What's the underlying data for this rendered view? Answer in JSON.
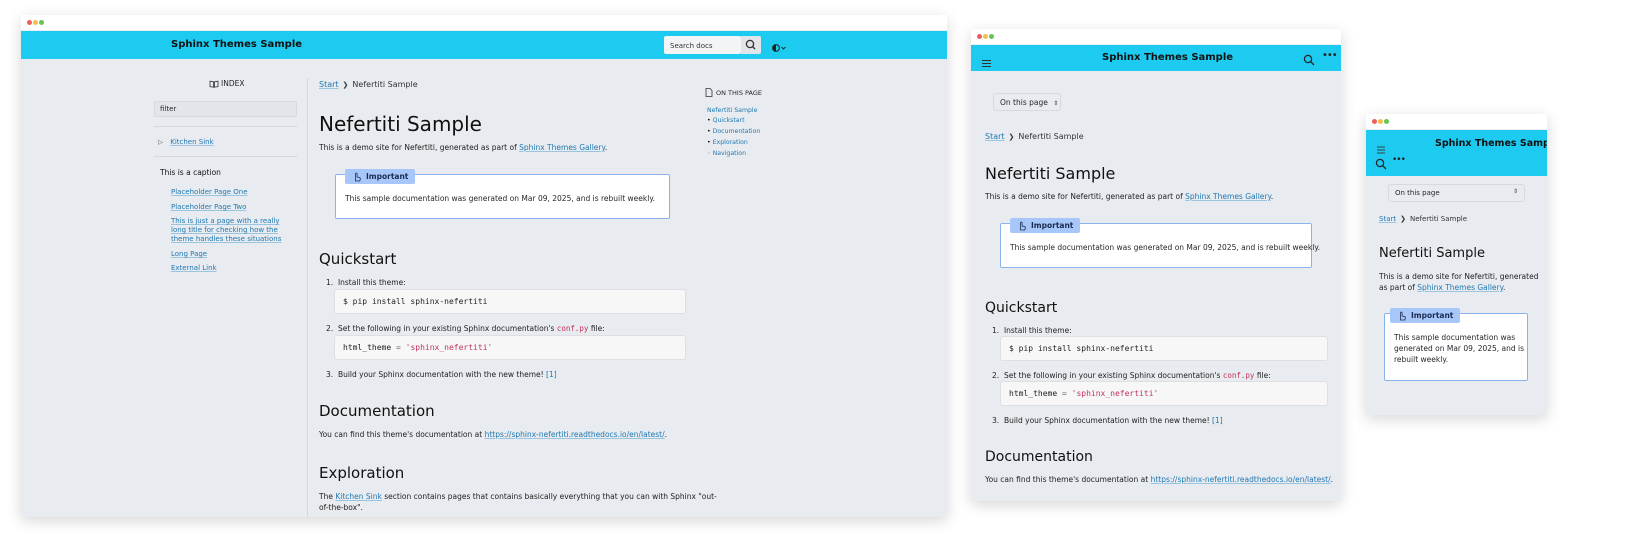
{
  "site_title": "Sphinx Themes Sample",
  "search": {
    "placeholder": "Search docs"
  },
  "sidebar": {
    "index_label": "INDEX",
    "filter_value": "filter",
    "kitchen_sink": "Kitchen Sink",
    "caption": "This is a caption",
    "pages": [
      "Placeholder Page One",
      "Placeholder Page Two",
      "This is just a page with a really long title for checking how the theme handles these situations",
      "Long Page",
      "External Link"
    ]
  },
  "toc": {
    "title": "ON THIS PAGE",
    "items": [
      "Nefertiti Sample",
      "Quickstart",
      "Documentation",
      "Exploration",
      "Navigation"
    ],
    "mobile_button": "On this page"
  },
  "breadcrumb": {
    "start": "Start",
    "current": "Nefertiti Sample"
  },
  "content": {
    "title": "Nefertiti Sample",
    "intro_before": "This is a demo site for Nefertiti, generated as part of ",
    "intro_link": "Sphinx Themes Gallery",
    "intro_after": ".",
    "intro_narrow_line1": "This is a demo site for Nefertiti, generated",
    "intro_narrow_line2_before": "as part of ",
    "admonition_title": "Important",
    "admonition_text": "This sample documentation was generated on Mar 09, 2025, and is rebuilt weekly.",
    "admonition_narrow": [
      "This sample documentation was",
      "generated on Mar 09, 2025, and is",
      "rebuilt weekly."
    ],
    "quickstart_heading": "Quickstart",
    "step1": "Install this theme:",
    "step1_code": "$ pip install sphinx-nefertiti",
    "step2_before": "Set the following in your existing Sphinx documentation's ",
    "step2_code": "conf.py",
    "step2_after": " file:",
    "step2_code_key": "html_theme",
    "step2_code_op": " = ",
    "step2_code_val": "'sphinx_nefertiti'",
    "step3": "Build your Sphinx documentation with the new theme! ",
    "step3_ref": "[1]",
    "documentation_heading": "Documentation",
    "documentation_text": "You can find this theme's documentation at ",
    "documentation_link": "https://sphinx-nefertiti.readthedocs.io/en/latest/",
    "exploration_heading": "Exploration",
    "exploration_before": "The ",
    "exploration_link": "Kitchen Sink",
    "exploration_after": " section contains pages that contains basically everything that you can with Sphinx \"out-",
    "exploration_line2": "of-the-box\"."
  },
  "colors": {
    "header": "#1ccbef",
    "link": "#2179b2",
    "admonition_border": "#8ab3ee",
    "admonition_tag": "#a7c7fb"
  },
  "icons": [
    "book-icon",
    "search-icon",
    "contrast-icon",
    "chevron-down-icon",
    "hamburger-icon",
    "more-icon",
    "page-icon",
    "hand-pointer-icon",
    "chevron-updown-icon",
    "chevron-right-icon"
  ]
}
